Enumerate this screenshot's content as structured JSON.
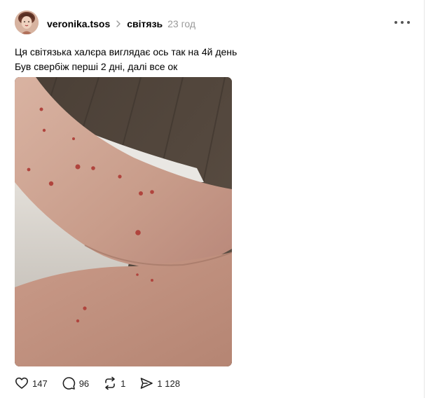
{
  "post": {
    "username": "veronika.tsos",
    "community": "світязь",
    "time": "23 год",
    "caption_lines": [
      "Ця світязька халєра виглядає ось так на 4й день",
      "Був свербіж перші 2 дні, далі все ок"
    ]
  },
  "stats": {
    "likes": "147",
    "replies": "96",
    "reposts": "1",
    "shares": "1 128"
  },
  "icons": {
    "avatar": "avatar",
    "chevron": "chevron-right-icon",
    "more": "more-horizontal-icon",
    "like": "heart-icon",
    "reply": "comment-icon",
    "repost": "repost-icon",
    "share": "share-icon"
  }
}
